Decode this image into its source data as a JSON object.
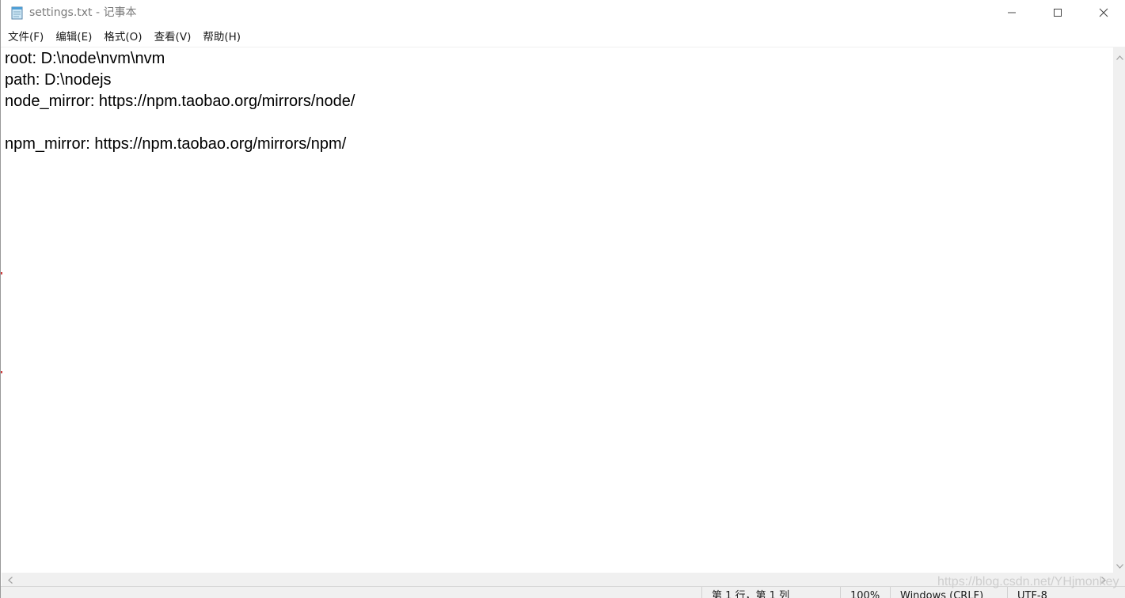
{
  "window": {
    "title": "settings.txt - 记事本"
  },
  "menu": {
    "items": [
      "文件(F)",
      "编辑(E)",
      "格式(O)",
      "查看(V)",
      "帮助(H)"
    ]
  },
  "editor": {
    "lines": [
      "root: D:\\node\\nvm\\nvm",
      "path: D:\\nodejs",
      "node_mirror: https://npm.taobao.org/mirrors/node/",
      "",
      "npm_mirror: https://npm.taobao.org/mirrors/npm/"
    ]
  },
  "status": {
    "position": "第 1 行，第 1 列",
    "zoom": "100%",
    "line_ending": "Windows (CRLF)",
    "encoding": "UTF-8"
  },
  "watermark": "https://blog.csdn.net/YHjmonkey",
  "icons": {
    "app": "notepad-icon",
    "minimize": "minimize-icon",
    "maximize": "maximize-icon",
    "close": "close-icon"
  },
  "colors": {
    "title_text": "#7a7a7a",
    "chrome": "#f0f0f0"
  }
}
